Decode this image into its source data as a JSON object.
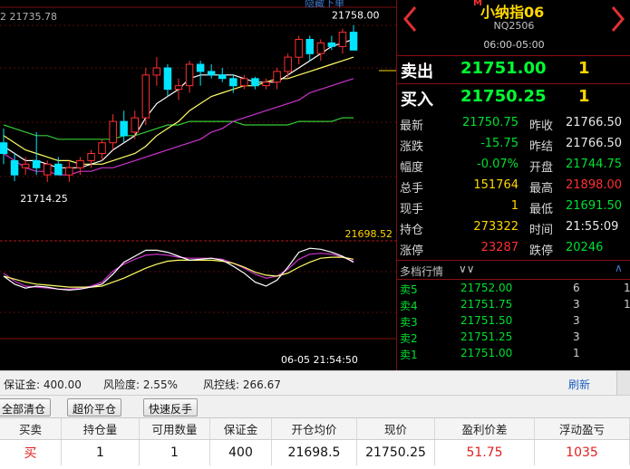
{
  "chart": {
    "top_label": "2 21735.78",
    "hide_link": "隐藏下单",
    "high_label": "21758.00",
    "low_label": "21714.25",
    "ref_label": "21698.52",
    "time_label": "06-05 21:54:50",
    "colors": {
      "up": "#ff3030",
      "down": "#00e5ff",
      "ma5": "#ffffff",
      "ma10": "#ffff66",
      "ma20": "#cc33cc",
      "ma60": "#33cc33"
    }
  },
  "chart_data": {
    "type": "candlestick",
    "ohlc": [
      {
        "o": 21725.0,
        "h": 21729.0,
        "l": 21719.0,
        "c": 21722.0
      },
      {
        "o": 21720.0,
        "h": 21722.0,
        "l": 21714.25,
        "c": 21716.0
      },
      {
        "o": 21718.0,
        "h": 21721.0,
        "l": 21716.0,
        "c": 21719.0
      },
      {
        "o": 21720.0,
        "h": 21728.0,
        "l": 21716.0,
        "c": 21718.0
      },
      {
        "o": 21716.0,
        "h": 21720.0,
        "l": 21714.0,
        "c": 21719.0
      },
      {
        "o": 21719.0,
        "h": 21721.0,
        "l": 21717.0,
        "c": 21716.0
      },
      {
        "o": 21716.0,
        "h": 21720.0,
        "l": 21714.0,
        "c": 21718.0
      },
      {
        "o": 21718.0,
        "h": 21721.0,
        "l": 21716.0,
        "c": 21720.0
      },
      {
        "o": 21720.0,
        "h": 21723.0,
        "l": 21718.0,
        "c": 21722.0
      },
      {
        "o": 21722.0,
        "h": 21726.0,
        "l": 21720.0,
        "c": 21725.0
      },
      {
        "o": 21725.0,
        "h": 21733.0,
        "l": 21723.0,
        "c": 21731.0
      },
      {
        "o": 21731.0,
        "h": 21734.0,
        "l": 21725.0,
        "c": 21727.0
      },
      {
        "o": 21728.0,
        "h": 21734.0,
        "l": 21726.0,
        "c": 21732.0
      },
      {
        "o": 21732.0,
        "h": 21746.0,
        "l": 21730.0,
        "c": 21744.0
      },
      {
        "o": 21744.0,
        "h": 21749.0,
        "l": 21741.0,
        "c": 21746.0
      },
      {
        "o": 21746.0,
        "h": 21747.0,
        "l": 21738.0,
        "c": 21740.0
      },
      {
        "o": 21740.0,
        "h": 21743.0,
        "l": 21737.0,
        "c": 21741.0
      },
      {
        "o": 21741.0,
        "h": 21748.0,
        "l": 21739.0,
        "c": 21747.0
      },
      {
        "o": 21747.0,
        "h": 21748.0,
        "l": 21741.0,
        "c": 21745.0
      },
      {
        "o": 21745.0,
        "h": 21747.0,
        "l": 21743.0,
        "c": 21744.0
      },
      {
        "o": 21744.0,
        "h": 21746.0,
        "l": 21742.0,
        "c": 21743.0
      },
      {
        "o": 21743.0,
        "h": 21744.0,
        "l": 21739.0,
        "c": 21741.0
      },
      {
        "o": 21741.0,
        "h": 21744.0,
        "l": 21740.0,
        "c": 21743.0
      },
      {
        "o": 21743.0,
        "h": 21743.5,
        "l": 21740.0,
        "c": 21741.0
      },
      {
        "o": 21741.0,
        "h": 21743.0,
        "l": 21740.0,
        "c": 21742.0
      },
      {
        "o": 21742.0,
        "h": 21746.0,
        "l": 21740.0,
        "c": 21745.0
      },
      {
        "o": 21745.0,
        "h": 21750.0,
        "l": 21743.0,
        "c": 21749.0
      },
      {
        "o": 21749.0,
        "h": 21755.0,
        "l": 21747.0,
        "c": 21754.0
      },
      {
        "o": 21754.0,
        "h": 21755.0,
        "l": 21748.0,
        "c": 21750.0
      },
      {
        "o": 21750.0,
        "h": 21754.0,
        "l": 21748.0,
        "c": 21753.0
      },
      {
        "o": 21753.0,
        "h": 21755.0,
        "l": 21751.0,
        "c": 21752.0
      },
      {
        "o": 21752.0,
        "h": 21757.0,
        "l": 21750.0,
        "c": 21756.0
      },
      {
        "o": 21756.0,
        "h": 21758.0,
        "l": 21751.0,
        "c": 21751.0
      }
    ],
    "ma5": [
      21724,
      21722,
      21720,
      21720,
      21719,
      21718,
      21718,
      21718,
      21719,
      21720,
      21723,
      21725,
      21727,
      21732,
      21736,
      21738,
      21740,
      21743,
      21744,
      21744,
      21744,
      21744,
      21743,
      21742,
      21742,
      21742,
      21744,
      21746,
      21748,
      21750,
      21752,
      21753,
      21754
    ],
    "ma10": [
      21727,
      21725,
      21723,
      21722,
      21721,
      21720,
      21720,
      21719,
      21719,
      21719,
      21720,
      21721,
      21722,
      21724,
      21727,
      21729,
      21731,
      21734,
      21736,
      21738,
      21739,
      21740,
      21741,
      21741,
      21742,
      21743,
      21743,
      21744,
      21745,
      21746,
      21747,
      21748,
      21749
    ],
    "ma20": [
      21722,
      21720,
      21718,
      21717,
      21717,
      21716,
      21716,
      21717,
      21717,
      21718,
      21718,
      21719,
      21720,
      21721,
      21722,
      21723,
      21724,
      21725,
      21726,
      21728,
      21729,
      21731,
      21732,
      21733,
      21734,
      21735,
      21736,
      21737,
      21739,
      21740,
      21741,
      21742,
      21743
    ],
    "ma60": [
      21730,
      21729,
      21728,
      21727,
      21727,
      21726,
      21726,
      21726,
      21726,
      21726,
      21726,
      21727,
      21727,
      21728,
      21729,
      21730,
      21730,
      21731,
      21731,
      21731,
      21731,
      21731,
      21730,
      21730,
      21730,
      21730,
      21730,
      21731,
      21731,
      21731,
      21731,
      21732,
      21732
    ],
    "osc_dif": [
      0.0,
      -0.8,
      -1.2,
      -1.0,
      -1.1,
      -1.3,
      -1.4,
      -1.3,
      -1.1,
      -0.8,
      0.2,
      1.4,
      2.0,
      2.6,
      2.6,
      2.4,
      2.0,
      1.6,
      1.7,
      1.8,
      1.6,
      1.0,
      0.3,
      -0.6,
      -1.0,
      -0.4,
      0.9,
      2.4,
      2.8,
      2.7,
      2.4,
      2.0,
      1.4
    ],
    "osc_dea": [
      0.0,
      -0.3,
      -0.6,
      -0.8,
      -0.9,
      -1.0,
      -1.1,
      -1.1,
      -1.1,
      -1.0,
      -0.6,
      -0.2,
      0.3,
      0.8,
      1.2,
      1.5,
      1.6,
      1.6,
      1.6,
      1.6,
      1.5,
      1.3,
      0.9,
      0.4,
      0.1,
      0.0,
      0.3,
      0.9,
      1.4,
      1.8,
      1.9,
      1.9,
      1.7
    ],
    "osc_k": [
      0.3,
      -0.5,
      -1.0,
      -1.1,
      -1.2,
      -1.3,
      -1.3,
      -1.2,
      -1.0,
      -0.6,
      0.5,
      1.2,
      1.7,
      2.1,
      2.2,
      2.1,
      1.9,
      1.8,
      1.8,
      1.8,
      1.7,
      1.3,
      0.8,
      0.2,
      -0.2,
      0.0,
      0.7,
      1.7,
      2.2,
      2.3,
      2.2,
      1.9,
      1.5
    ],
    "ylim": [
      21698.52,
      21763.0
    ]
  },
  "quote": {
    "title_mark": "M",
    "title": "小纳指06",
    "code": "NQ2506",
    "hours": "06:00-05:00",
    "sell": {
      "label": "卖出",
      "price": "21751.00",
      "volume": "1"
    },
    "buy": {
      "label": "买入",
      "price": "21750.25",
      "volume": "1"
    },
    "stats": [
      {
        "l1": "最新",
        "v1": "21750.75",
        "c1": "#00e030",
        "l2": "昨收",
        "v2": "21766.50",
        "c2": "#e8e8e8"
      },
      {
        "l1": "涨跌",
        "v1": "-15.75",
        "c1": "#00e030",
        "l2": "昨结",
        "v2": "21766.50",
        "c2": "#e8e8e8"
      },
      {
        "l1": "幅度",
        "v1": "-0.07%",
        "c1": "#00e030",
        "l2": "开盘",
        "v2": "21744.75",
        "c2": "#00e030"
      },
      {
        "l1": "总手",
        "v1": "151764",
        "c1": "#ffd700",
        "l2": "最高",
        "v2": "21898.00",
        "c2": "#ff3030"
      },
      {
        "l1": "现手",
        "v1": "1",
        "c1": "#ffd700",
        "l2": "最低",
        "v2": "21691.50",
        "c2": "#00e030"
      },
      {
        "l1": "持仓",
        "v1": "273322",
        "c1": "#ffd700",
        "l2": "时间",
        "v2": "21:55:09",
        "c2": "#e8e8e8"
      },
      {
        "l1": "涨停",
        "v1": "23287",
        "c1": "#ff3030",
        "l2": "跌停",
        "v2": "20246",
        "c2": "#00e030"
      }
    ],
    "depth_title": "多档行情",
    "depth": [
      {
        "label": "卖5",
        "price": "21752.00",
        "vol": "6",
        "other": "1"
      },
      {
        "label": "卖4",
        "price": "21751.75",
        "vol": "3",
        "other": "1"
      },
      {
        "label": "卖3",
        "price": "21751.50",
        "vol": "3",
        "other": ""
      },
      {
        "label": "卖2",
        "price": "21751.25",
        "vol": "3",
        "other": ""
      },
      {
        "label": "卖1",
        "price": "21751.00",
        "vol": "1",
        "other": ""
      }
    ]
  },
  "account": {
    "margin": "保证金: 400.00",
    "risk": "风险度: 2.55%",
    "control": "风控线: 266.67",
    "refresh": "刷新"
  },
  "buttons": {
    "close_all": "全部清仓",
    "over_price": "超价平仓",
    "reverse": "快速反手"
  },
  "table": {
    "headers": [
      "买卖",
      "持仓量",
      "可用数量",
      "保证金",
      "开仓均价",
      "现价",
      "盈利价差",
      "浮动盈亏"
    ],
    "row": [
      "买",
      "1",
      "1",
      "400",
      "21698.5",
      "21750.25",
      "51.75",
      "1035"
    ]
  }
}
